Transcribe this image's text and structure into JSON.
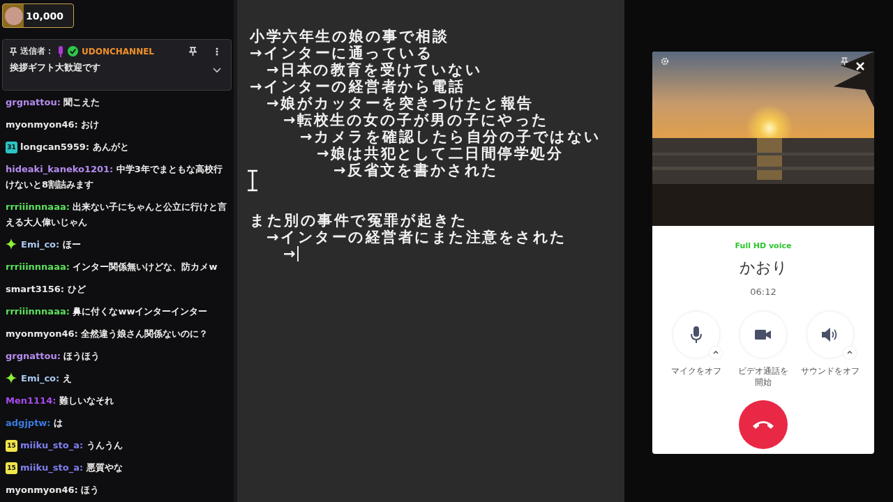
{
  "gift_bar": {
    "amount": "10,000"
  },
  "pinned": {
    "label": "送信者：",
    "sender": "UDONCHANNEL",
    "message": "挨拶ギフト大歓迎です"
  },
  "chat": [
    {
      "user": "grgnattou:",
      "color": "#b68cf0",
      "text": "聞こえた"
    },
    {
      "user": "myonmyon46:",
      "color": "#e8e8e8",
      "text": "おけ"
    },
    {
      "user": "longcan5959:",
      "color": "#e8e8e8",
      "text": "あんがと",
      "badge": {
        "kind": "number",
        "label": "31",
        "color": "#2bc4c4"
      }
    },
    {
      "user": "hideaki_kaneko1201:",
      "color": "#b68cf0",
      "text": "中学3年でまともな高校行けないと8割詰みます"
    },
    {
      "user": "rrriiinnnaaa:",
      "color": "#5ce05c",
      "text": "出来ない子にちゃんと公立に行けと言える大人偉いじゃん"
    },
    {
      "user": "Emi_co:",
      "color": "#a9c8f0",
      "text": "ほー",
      "badge": {
        "kind": "sparkle",
        "color": "#8ff03a"
      }
    },
    {
      "user": "rrriiinnnaaa:",
      "color": "#5ce05c",
      "text": "インター関係無いけどな、防カメw"
    },
    {
      "user": "smart3156:",
      "color": "#e8e8e8",
      "text": "ひど"
    },
    {
      "user": "rrriiinnnaaa:",
      "color": "#5ce05c",
      "text": "鼻に付くなwwインターインター"
    },
    {
      "user": "myonmyon46:",
      "color": "#e8e8e8",
      "text": "全然違う娘さん関係ないのに？"
    },
    {
      "user": "grgnattou:",
      "color": "#b68cf0",
      "text": "ほうほう"
    },
    {
      "user": "Emi_co:",
      "color": "#a9c8f0",
      "text": "え",
      "badge": {
        "kind": "sparkle",
        "color": "#8ff03a"
      }
    },
    {
      "user": "Men1114:",
      "color": "#a64cf0",
      "text": "難しいなそれ"
    },
    {
      "user": "adgjptw:",
      "color": "#3c7be0",
      "text": "は"
    },
    {
      "user": "miiku_sto_a:",
      "color": "#7f7ff0",
      "text": "うんうん",
      "badge": {
        "kind": "number",
        "label": "15",
        "color": "#f0e64a"
      }
    },
    {
      "user": "miiku_sto_a:",
      "color": "#7f7ff0",
      "text": "悪質やな",
      "badge": {
        "kind": "number",
        "label": "15",
        "color": "#f0e64a"
      }
    },
    {
      "user": "myonmyon46:",
      "color": "#e8e8e8",
      "text": "ほう"
    }
  ],
  "notes": [
    [
      {
        "text": "小学六年生の娘の事で相談"
      },
      {
        "text": "→インターに通っている",
        "children": [
          {
            "text": "→日本の教育を受けていない"
          }
        ]
      },
      {
        "text": "→インターの経営者から電話",
        "children": [
          {
            "text": "→娘がカッターを突きつけたと報告",
            "children": [
              {
                "text": "→転校生の女の子が男の子にやった",
                "children": [
                  {
                    "text": "→カメラを確認したら自分の子ではない",
                    "children": [
                      {
                        "text": "→娘は共犯として二日間停学処分",
                        "children": [
                          {
                            "text": "→反省文を書かされた"
                          }
                        ]
                      }
                    ]
                  }
                ]
              }
            ]
          }
        ]
      }
    ],
    [
      {
        "text": "また別の事件で冤罪が起きた",
        "children": [
          {
            "text": "→インターの経営者にまた注意をされた",
            "children": [
              {
                "text": "→",
                "cursor": true
              }
            ]
          }
        ]
      }
    ]
  ],
  "call": {
    "quality": "Full HD voice",
    "name": "かおり",
    "duration": "06:12",
    "controls": [
      {
        "kind": "mic",
        "label_lines": [
          "マイクをオフ"
        ],
        "menu": true
      },
      {
        "kind": "video",
        "label_lines": [
          "ビデオ通話を",
          "開始"
        ],
        "menu": false
      },
      {
        "kind": "sound",
        "label_lines": [
          "サウンドをオフ"
        ],
        "menu": true
      }
    ]
  }
}
